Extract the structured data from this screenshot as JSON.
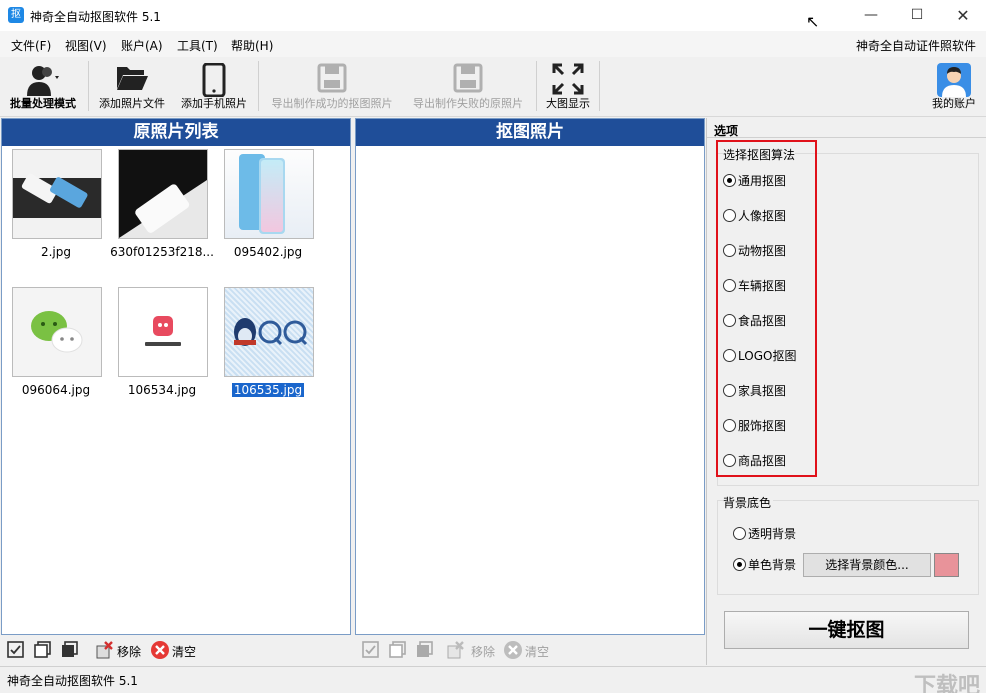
{
  "window": {
    "title": "神奇全自动抠图软件 5.1",
    "icon_char": "抠",
    "minimize": "—",
    "maximize": "☐",
    "close": "✕"
  },
  "menu": {
    "items": [
      "文件(F)",
      "视图(V)",
      "账户(A)",
      "工具(T)",
      "帮助(H)"
    ],
    "right_link": "神奇全自动证件照软件"
  },
  "toolbar": {
    "batch": "批量处理模式",
    "add_photo": "添加照片文件",
    "add_phone": "添加手机照片",
    "export_success": "导出制作成功的抠图照片",
    "export_failed": "导出制作失败的原照片",
    "large_view": "大图显示",
    "account": "我的账户"
  },
  "left_panel": {
    "title": "原照片列表",
    "thumbnails": [
      {
        "label": "2.jpg",
        "icon": "phone-pair-image",
        "selected": false
      },
      {
        "label": "630f01253f218...",
        "icon": "white-phone-image",
        "selected": false
      },
      {
        "label": "095402.jpg",
        "icon": "huawei-phone-image",
        "selected": false
      },
      {
        "label": "096064.jpg",
        "icon": "wechat-logo-image",
        "selected": false
      },
      {
        "label": "106534.jpg",
        "icon": "pipixia-logo-image",
        "selected": false
      },
      {
        "label": "106535.jpg",
        "icon": "qq-logo-image",
        "selected": true
      }
    ],
    "remove": "移除",
    "clear": "清空"
  },
  "mid_panel": {
    "title": "抠图照片",
    "remove": "移除",
    "clear": "清空"
  },
  "options": {
    "header": "选项",
    "algo_title": "选择抠图算法",
    "algos": [
      {
        "label": "通用抠图",
        "checked": true
      },
      {
        "label": "人像抠图",
        "checked": false
      },
      {
        "label": "动物抠图",
        "checked": false
      },
      {
        "label": "车辆抠图",
        "checked": false
      },
      {
        "label": "食品抠图",
        "checked": false
      },
      {
        "label": "LOGO抠图",
        "checked": false
      },
      {
        "label": "家具抠图",
        "checked": false
      },
      {
        "label": "服饰抠图",
        "checked": false
      },
      {
        "label": "商品抠图",
        "checked": false
      }
    ],
    "bg_title": "背景底色",
    "bg_transparent": "透明背景",
    "bg_solid": "单色背景",
    "bg_color_button": "选择背景颜色...",
    "bg_color": "#e8939a",
    "go_button": "一键抠图"
  },
  "status": {
    "text": "神奇全自动抠图软件 5.1"
  },
  "colors": {
    "panel_header": "#1f4e99",
    "highlight_box": "#e0111a",
    "selection": "#1a66cc"
  }
}
